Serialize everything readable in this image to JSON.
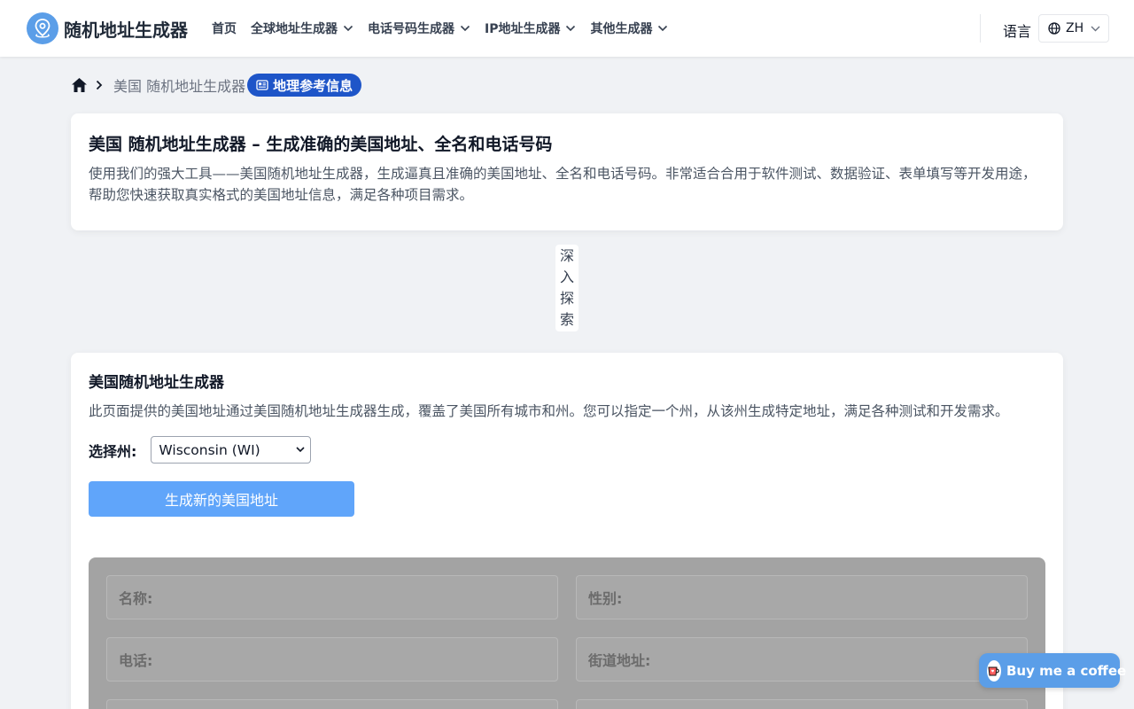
{
  "navbar": {
    "brand": "随机地址生成器",
    "items": [
      {
        "label": "首页",
        "has_dropdown": false
      },
      {
        "label": "全球地址生成器",
        "has_dropdown": true
      },
      {
        "label": "电话号码生成器",
        "has_dropdown": true
      },
      {
        "label": "IP地址生成器",
        "has_dropdown": true
      },
      {
        "label": "其他生成器",
        "has_dropdown": true
      }
    ],
    "language_label": "语言",
    "language_code": "ZH"
  },
  "breadcrumb": {
    "current": "美国 随机地址生成器",
    "geo_badge": "地理参考信息"
  },
  "intro": {
    "title": "美国 随机地址生成器 – 生成准确的美国地址、全名和电话号码",
    "description": "使用我们的强大工具——美国随机地址生成器，生成逼真且准确的美国地址、全名和电话号码。非常适合合用于软件测试、数据验证、表单填写等开发用途，帮助您快速获取真实格式的美国地址信息，满足各种项目需求。"
  },
  "explore": [
    "深",
    "入",
    "探",
    "索"
  ],
  "generator": {
    "title": "美国随机地址生成器",
    "description": "此页面提供的美国地址通过美国随机地址生成器生成，覆盖了美国所有城市和州。您可以指定一个州，从该州生成特定地址，满足各种测试和开发需求。",
    "state_label": "选择州:",
    "state_value": "Wisconsin (WI)",
    "button_label": "生成新的美国地址",
    "fields": {
      "name": "名称:",
      "gender": "性别:",
      "phone": "电话:",
      "street": "街道地址:"
    }
  },
  "bmc": {
    "label": "Buy me a coffee"
  },
  "colors": {
    "accent": "#1e55c8",
    "button": "#60a5fa",
    "brand": "#5b9ee8"
  }
}
